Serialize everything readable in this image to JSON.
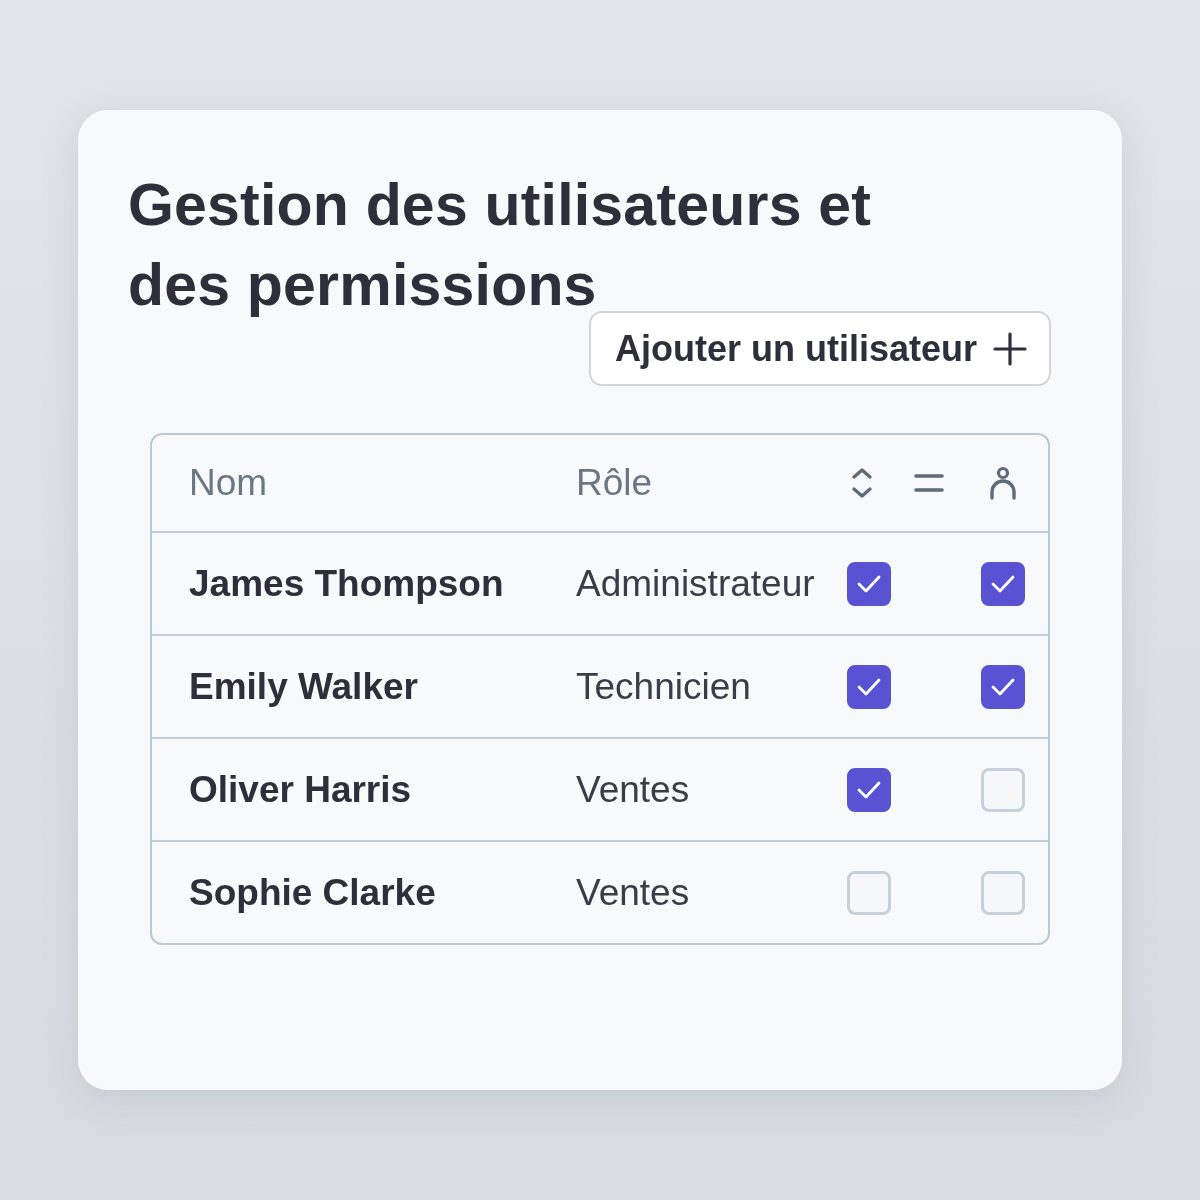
{
  "title": "Gestion des utilisateurs et des permissions",
  "add_button": {
    "label": "Ajouter un utilisateur"
  },
  "table": {
    "columns": [
      "Nom",
      "Rôle"
    ],
    "rows": [
      {
        "name": "James Thompson",
        "role": "Administrateur",
        "permissions": [
          {
            "checked": true
          },
          {
            "checked": true
          }
        ]
      },
      {
        "name": "Emily Walker",
        "role": "Technicien",
        "permissions": [
          {
            "checked": true
          },
          {
            "checked": true
          }
        ]
      },
      {
        "name": "Oliver Harris",
        "role": "Ventes",
        "permissions": [
          {
            "checked": true
          },
          {
            "checked": false
          }
        ]
      },
      {
        "name": "Sophie Clarke",
        "role": "Ventes",
        "permissions": [
          {
            "checked": false
          },
          {
            "checked": false
          }
        ]
      }
    ]
  }
}
